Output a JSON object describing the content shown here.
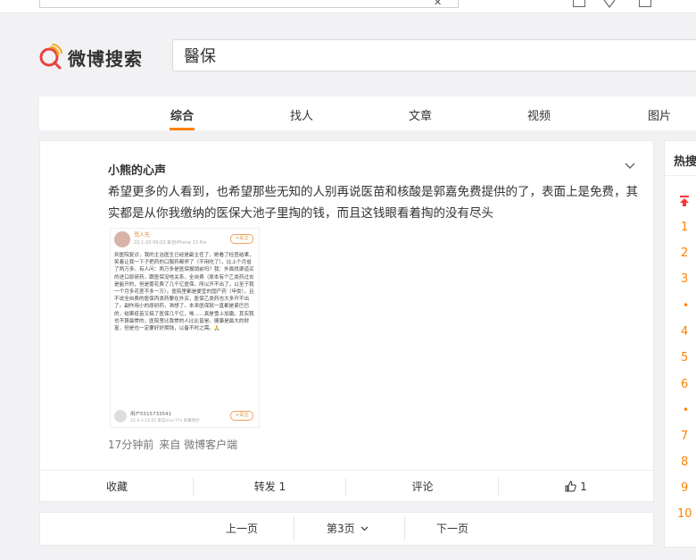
{
  "header": {
    "logo_text": "微博搜索",
    "search_value": "醫保"
  },
  "tabs": [
    {
      "label": "综合",
      "active": true
    },
    {
      "label": "找人"
    },
    {
      "label": "文章"
    },
    {
      "label": "视频"
    },
    {
      "label": "图片"
    }
  ],
  "post": {
    "author": "小熊的心声",
    "text": "希望更多的人看到，也希望那些无知的人别再说医苗和核酸是郭嘉免费提供的了，表面上是免费，其实都是从你我缴纳的医保大池子里掏的钱，而且这钱眼看着掏的没有尽头",
    "time": "17分钟前",
    "source": "来自 微博客户端",
    "embedded": {
      "name": "骂人先",
      "meta": "22-1-20 09:02 来自iPhone 13 Pro",
      "follow": "+关注",
      "body": "到医院复诊，我的主治医生已经是副主任了，她看了检查结果，笑着让我一下子把药的口服药都停了（不用吃了），比上个月省了两万多。有人问：两万多是医保报销前吗？我：外面找渠道买的进口原研药，跟医保没啥关系，全自费（原本有个乙类药过去是能开的，但是蕾花费了几千亿医保，所以开不出了，以至于我一个月多花差不多一万）。医院里都是便宜的国产药（甲类），且不说全自费的医保丙类药要在外买，医保乙类药也大多开不出了。副作用小的原研药，滞想了。本来医保就一直都是紧巴巴的，结果疫苗又搞了医保几千亿，唉……真是雪上加霜。其实我也不算最惨的，医院里比我惨的人比比皆是。健康是最大的财富，但是也一定要好好攒钱，以备不时之需。🙏",
      "footer_name": "用户5515733541",
      "footer_meta": "22-2-3 12:22 来自vivo Y7s 屏幕保护",
      "footer_follow": "+关注"
    },
    "actions": {
      "favorite": "收藏",
      "repost": "转发 1",
      "comment": "评论",
      "like": "1"
    }
  },
  "pager": {
    "prev": "上一页",
    "current": "第3页",
    "next": "下一页"
  },
  "hot": {
    "title": "热搜",
    "ranks": [
      "1",
      "2",
      "3",
      "•",
      "4",
      "5",
      "6",
      "•",
      "7",
      "8",
      "9",
      "10"
    ]
  },
  "colors": {
    "accent": "#ff8200",
    "logo_red": "#e8433b"
  }
}
